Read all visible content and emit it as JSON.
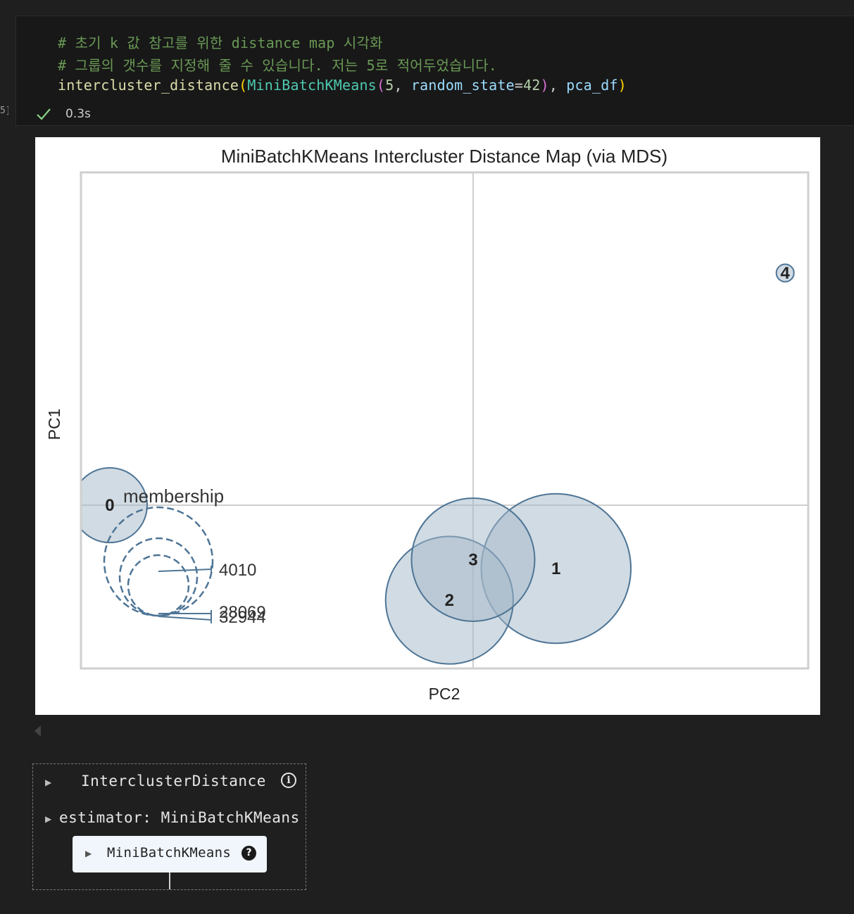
{
  "cell": {
    "exec_count": "5]",
    "code_lines": [
      [
        {
          "t": "# 초기 k 값 참고를 위한 distance map 시각화",
          "c": "c-comment"
        }
      ],
      [
        {
          "t": "# 그룹의 갯수를 지정해 줄 수 있습니다. 저는 5로 적어두었습니다.",
          "c": "c-comment"
        }
      ],
      [
        {
          "t": "intercluster_distance",
          "c": "c-func"
        },
        {
          "t": "(",
          "c": "c-paren1"
        },
        {
          "t": "MiniBatchKMeans",
          "c": "c-class"
        },
        {
          "t": "(",
          "c": "c-paren2"
        },
        {
          "t": "5",
          "c": "c-num"
        },
        {
          "t": ", ",
          "c": "c-plain"
        },
        {
          "t": "random_state",
          "c": "c-param"
        },
        {
          "t": "=",
          "c": "c-plain"
        },
        {
          "t": "42",
          "c": "c-num"
        },
        {
          "t": ")",
          "c": "c-paren2"
        },
        {
          "t": ", ",
          "c": "c-plain"
        },
        {
          "t": "pca_df",
          "c": "c-param"
        },
        {
          "t": ")",
          "c": "c-paren1"
        }
      ]
    ],
    "status": "0.3s"
  },
  "chart_data": {
    "type": "scatter",
    "title": "MiniBatchKMeans Intercluster Distance Map (via MDS)",
    "xlabel": "PC2",
    "ylabel": "PC1",
    "grid": "crosshair at origin",
    "clusters": [
      {
        "label": "0",
        "x": -0.92,
        "y": 0.0,
        "size": 0.17
      },
      {
        "label": "1",
        "x": 0.21,
        "y": -0.36,
        "size": 0.34
      },
      {
        "label": "2",
        "x": -0.06,
        "y": -0.54,
        "size": 0.29
      },
      {
        "label": "3",
        "x": 0.0,
        "y": -0.31,
        "size": 0.28
      },
      {
        "label": "4",
        "x": 0.79,
        "y": 1.32,
        "size": 0.04
      }
    ],
    "legend": {
      "title": "membership",
      "entries": [
        "4010",
        "28069",
        "32944"
      ]
    },
    "colors": {
      "fill": "#a3b8c8",
      "stroke": "#4e7596"
    }
  },
  "widget": {
    "title": "InterclusterDistance",
    "estimator_label": "estimator: MiniBatchKMeans",
    "estimator_name": "MiniBatchKMeans",
    "info_glyph": "i",
    "help_glyph": "?"
  }
}
